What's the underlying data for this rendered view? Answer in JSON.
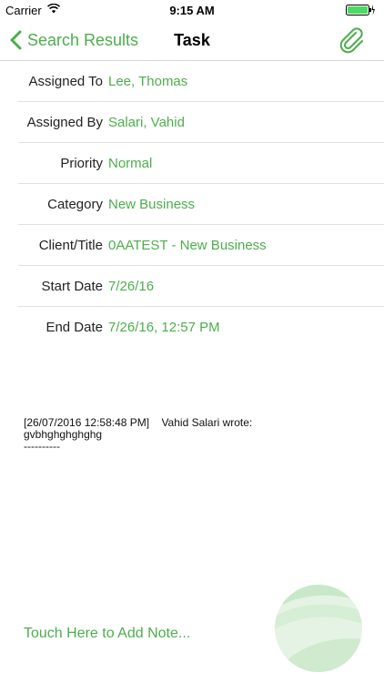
{
  "status_bar": {
    "carrier": "Carrier",
    "time": "9:15 AM",
    "wifi_icon": "wifi-icon",
    "battery_icon": "battery-charging-icon",
    "battery_color": "#4cd964"
  },
  "nav": {
    "back_label": "Search Results",
    "title": "Task",
    "attach_icon": "paperclip-icon",
    "accent_color": "#4cae4c"
  },
  "details": [
    {
      "label": "Assigned To",
      "value": "Lee, Thomas"
    },
    {
      "label": "Assigned By",
      "value": "Salari, Vahid"
    },
    {
      "label": "Priority",
      "value": "Normal"
    },
    {
      "label": "Category",
      "value": "New Business"
    },
    {
      "label": "Client/Title",
      "value": "0AATEST - New Business"
    },
    {
      "label": "Start Date",
      "value": "7/26/16"
    },
    {
      "label": "End Date",
      "value": "7/26/16, 12:57 PM"
    }
  ],
  "notes": {
    "header": "[26/07/2016 12:58:48 PM]    Vahid Salari wrote:",
    "body": "gvbhghghghghg",
    "separator": "----------"
  },
  "add_note_label": "Touch Here to Add Note..."
}
